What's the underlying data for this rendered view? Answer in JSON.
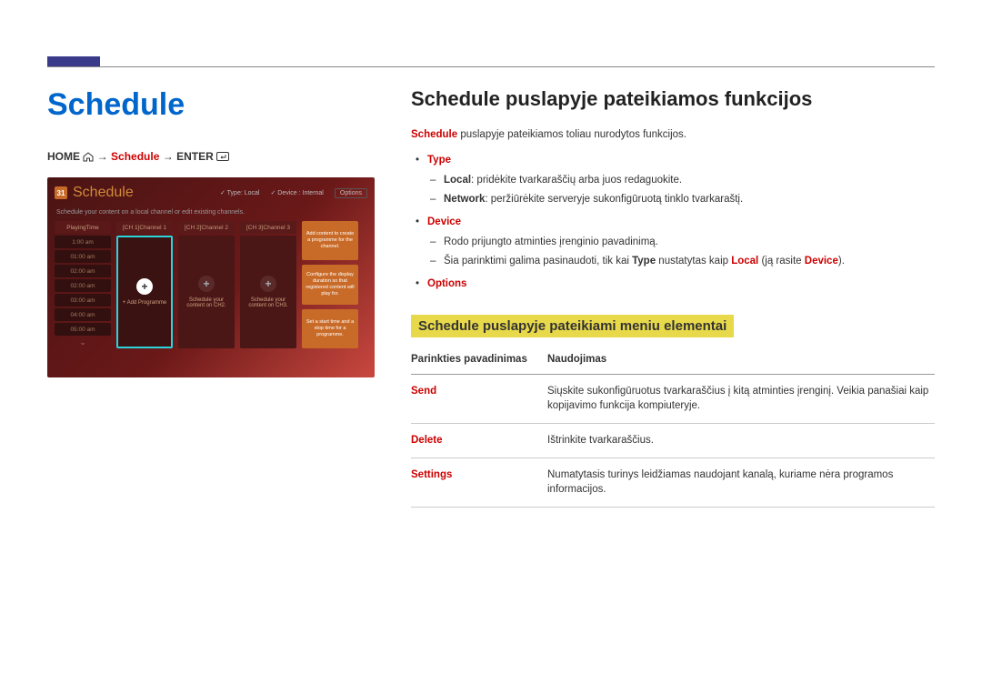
{
  "left": {
    "heading": "Schedule",
    "breadcrumb": {
      "home": "HOME",
      "schedule": "Schedule",
      "enter": "ENTER",
      "arrow": "→"
    },
    "screenshot": {
      "cal_num": "31",
      "title": "Schedule",
      "meta_type_label": "Type: Local",
      "meta_device_label": "Device : Internal",
      "meta_options": "Options",
      "subtitle": "Schedule your content on a local channel or edit existing channels.",
      "times_header": "PlayingTime",
      "times": [
        "1:00 am",
        "01:00 am",
        "02:00 am",
        "02:00 am",
        "03:00 am",
        "04:00 am",
        "05:00 am"
      ],
      "channels": [
        {
          "hdr": "[CH 1]Channel 1",
          "label": "+ Add Programme",
          "selected": true
        },
        {
          "hdr": "[CH 2]Channel 2",
          "label": "Schedule your content on CH2.",
          "selected": false
        },
        {
          "hdr": "[CH 3]Channel 3",
          "label": "Schedule your content on CH3.",
          "selected": false
        }
      ],
      "side": [
        "Add content to create a programme for the channel.",
        "Configure the display duration so that registered content will play for.",
        "Set a start time and a stop time for a programme."
      ]
    }
  },
  "right": {
    "heading": "Schedule puslapyje pateikiamos funkcijos",
    "intro_prefix": "Schedule",
    "intro_rest": " puslapyje pateikiamos toliau nurodytos funkcijos.",
    "type": {
      "label": "Type",
      "local_label": "Local",
      "local_text": ": pridėkite tvarkaraščių arba juos redaguokite.",
      "network_label": "Network",
      "network_text": ": peržiūrėkite serveryje sukonfigūruotą tinklo tvarkaraštį."
    },
    "device": {
      "label": "Device",
      "line1": "Rodo prijungto atminties įrenginio pavadinimą.",
      "note_pre": "Šia parinktimi galima pasinaudoti, tik kai ",
      "note_type": "Type",
      "note_mid": " nustatytas kaip ",
      "note_local": "Local",
      "note_post1": " (ją rasite ",
      "note_device": "Device",
      "note_post2": ")."
    },
    "options_label": "Options",
    "subheading": "Schedule puslapyje pateikiami meniu elementai",
    "table": {
      "th1": "Parinkties pavadinimas",
      "th2": "Naudojimas",
      "rows": [
        {
          "name": "Send",
          "desc": "Siųskite sukonfigūruotus tvarkaraščius į kitą atminties įrenginį. Veikia panašiai kaip kopijavimo funkcija kompiuteryje."
        },
        {
          "name": "Delete",
          "desc": "Ištrinkite tvarkaraščius."
        },
        {
          "name": "Settings",
          "desc": "Numatytasis turinys leidžiamas naudojant kanalą, kuriame nėra programos informacijos."
        }
      ]
    }
  }
}
